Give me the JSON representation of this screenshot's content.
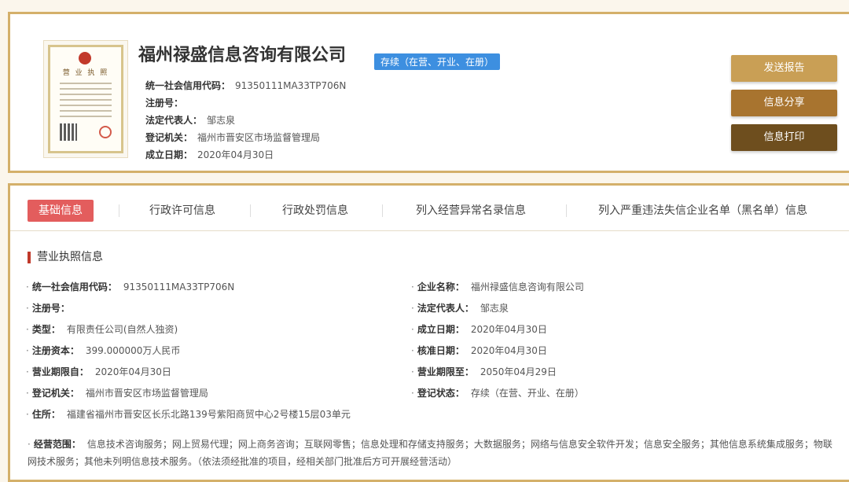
{
  "company": {
    "name": "福州禄盛信息咨询有限公司",
    "status": "存续（在营、开业、在册）",
    "license_title": "营 业 执 照",
    "summary": [
      {
        "label": "统一社会信用代码：",
        "value": "91350111MA33TP706N"
      },
      {
        "label": "注册号：",
        "value": ""
      },
      {
        "label": "法定代表人：",
        "value": "邹志泉"
      },
      {
        "label": "登记机关：",
        "value": "福州市晋安区市场监督管理局"
      },
      {
        "label": "成立日期：",
        "value": "2020年04月30日"
      }
    ]
  },
  "actions": {
    "send_report": "发送报告",
    "share": "信息分享",
    "print": "信息打印"
  },
  "tabs": [
    {
      "label": "基础信息"
    },
    {
      "label": "行政许可信息"
    },
    {
      "label": "行政处罚信息"
    },
    {
      "label": "列入经营异常名录信息"
    },
    {
      "label": "列入严重违法失信企业名单（黑名单）信息"
    }
  ],
  "section": {
    "title": "营业执照信息"
  },
  "fields_left": [
    {
      "label": "统一社会信用代码：",
      "value": "91350111MA33TP706N"
    },
    {
      "label": "注册号：",
      "value": ""
    },
    {
      "label": "类型：",
      "value": "有限责任公司(自然人独资)"
    },
    {
      "label": "注册资本：",
      "value": "399.000000万人民币"
    },
    {
      "label": "营业期限自：",
      "value": "2020年04月30日"
    },
    {
      "label": "登记机关：",
      "value": "福州市晋安区市场监督管理局"
    },
    {
      "label": "住所：",
      "value": "福建省福州市晋安区长乐北路139号紫阳商贸中心2号楼15层03单元"
    }
  ],
  "fields_right": [
    {
      "label": "企业名称：",
      "value": "福州禄盛信息咨询有限公司"
    },
    {
      "label": "法定代表人：",
      "value": "邹志泉"
    },
    {
      "label": "成立日期：",
      "value": "2020年04月30日"
    },
    {
      "label": "核准日期：",
      "value": "2020年04月30日"
    },
    {
      "label": "营业期限至：",
      "value": "2050年04月29日"
    },
    {
      "label": "登记状态：",
      "value": "存续（在营、开业、在册）"
    }
  ],
  "scope": {
    "label": "经营范围：",
    "value": "信息技术咨询服务；网上贸易代理；网上商务咨询；互联网零售；信息处理和存储支持服务；大数据服务；网络与信息安全软件开发；信息安全服务；其他信息系统集成服务；物联网技术服务；其他未列明信息技术服务。（依法须经批准的项目，经相关部门批准后方可开展经营活动）"
  },
  "bullet": "·",
  "colors": {
    "accent_border": "#d4b06a",
    "status_blue": "#3d8fe0",
    "active_tab": "#e35d5d"
  }
}
